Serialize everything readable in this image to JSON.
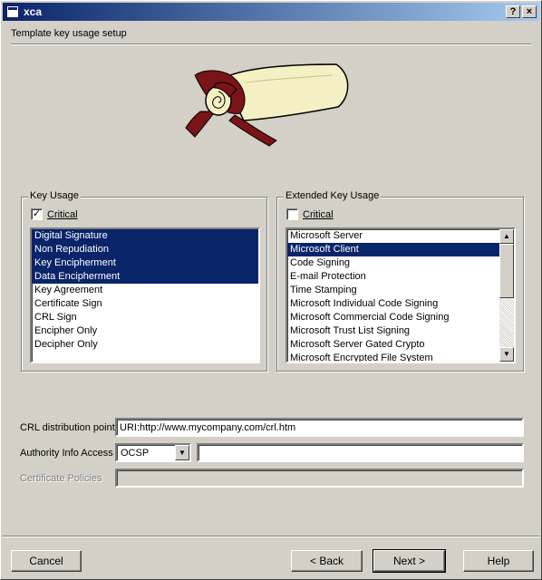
{
  "window": {
    "title": "xca",
    "help_label": "?",
    "close_label": "×"
  },
  "header": {
    "title": "Template key usage setup"
  },
  "key_usage": {
    "title": "Key Usage",
    "critical_label": "Critical",
    "critical_checked": true,
    "items": [
      {
        "label": "Digital Signature",
        "selected": true
      },
      {
        "label": "Non Repudiation",
        "selected": true
      },
      {
        "label": "Key Encipherment",
        "selected": true
      },
      {
        "label": "Data Encipherment",
        "selected": true
      },
      {
        "label": "Key Agreement",
        "selected": false
      },
      {
        "label": "Certificate Sign",
        "selected": false
      },
      {
        "label": "CRL Sign",
        "selected": false
      },
      {
        "label": "Encipher Only",
        "selected": false
      },
      {
        "label": "Decipher Only",
        "selected": false
      }
    ]
  },
  "extended_key_usage": {
    "title": "Extended Key Usage",
    "critical_label": "Critical",
    "critical_checked": false,
    "items": [
      {
        "label": "Microsoft Server",
        "selected": false
      },
      {
        "label": "Microsoft Client",
        "selected": true
      },
      {
        "label": "Code Signing",
        "selected": false
      },
      {
        "label": "E-mail Protection",
        "selected": false
      },
      {
        "label": "Time Stamping",
        "selected": false
      },
      {
        "label": "Microsoft Individual Code Signing",
        "selected": false
      },
      {
        "label": "Microsoft Commercial Code Signing",
        "selected": false
      },
      {
        "label": "Microsoft Trust List Signing",
        "selected": false
      },
      {
        "label": "Microsoft Server Gated Crypto",
        "selected": false
      },
      {
        "label": "Microsoft Encrypted File System",
        "selected": false
      }
    ],
    "scroll_up_icon": "▲",
    "scroll_down_icon": "▼"
  },
  "fields": {
    "crl_label": "CRL distribution point",
    "crl_value": "URI:http://www.mycompany.com/crl.htm",
    "aia_label": "Authority Info Access",
    "aia_method": "OCSP",
    "aia_value": "",
    "policies_label": "Certificate Policies",
    "policies_value": "",
    "dropdown_icon": "▼"
  },
  "buttons": {
    "cancel": "Cancel",
    "back": "< Back",
    "next": "Next >",
    "help": "Help"
  },
  "colors": {
    "selection": "#0a246a",
    "face": "#d4d0c8"
  }
}
